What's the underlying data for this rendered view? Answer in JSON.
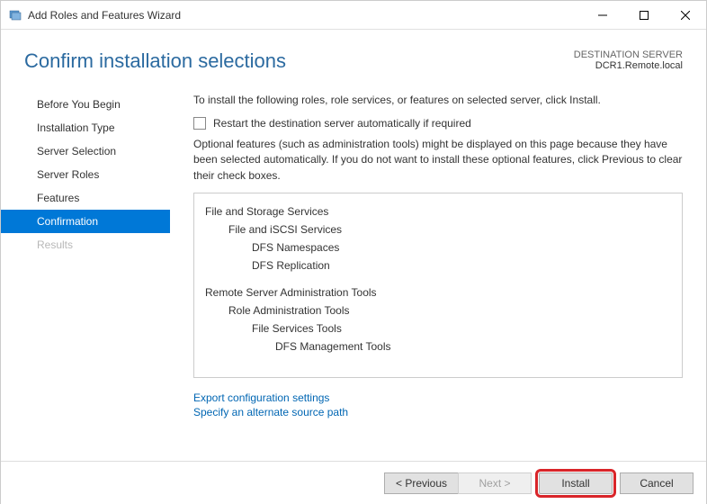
{
  "titlebar": {
    "app_icon_name": "server-manager-icon",
    "title": "Add Roles and Features Wizard"
  },
  "header": {
    "heading": "Confirm installation selections",
    "destination_label": "DESTINATION SERVER",
    "destination_value": "DCR1.Remote.local"
  },
  "sidebar": {
    "items": [
      {
        "label": "Before You Begin",
        "active": false,
        "disabled": false
      },
      {
        "label": "Installation Type",
        "active": false,
        "disabled": false
      },
      {
        "label": "Server Selection",
        "active": false,
        "disabled": false
      },
      {
        "label": "Server Roles",
        "active": false,
        "disabled": false
      },
      {
        "label": "Features",
        "active": false,
        "disabled": false
      },
      {
        "label": "Confirmation",
        "active": true,
        "disabled": false
      },
      {
        "label": "Results",
        "active": false,
        "disabled": true
      }
    ]
  },
  "content": {
    "intro": "To install the following roles, role services, or features on selected server, click Install.",
    "checkbox_label": "Restart the destination server automatically if required",
    "checkbox_checked": false,
    "note": "Optional features (such as administration tools) might be displayed on this page because they have been selected automatically. If you do not want to install these optional features, click Previous to clear their check boxes.",
    "tree": [
      {
        "label": "File and Storage Services",
        "level": 0
      },
      {
        "label": "File and iSCSI Services",
        "level": 1
      },
      {
        "label": "DFS Namespaces",
        "level": 2
      },
      {
        "label": "DFS Replication",
        "level": 2
      },
      {
        "label": "Remote Server Administration Tools",
        "level": 0,
        "gap": true
      },
      {
        "label": "Role Administration Tools",
        "level": 1
      },
      {
        "label": "File Services Tools",
        "level": 2
      },
      {
        "label": "DFS Management Tools",
        "level": 2,
        "extra_indent": true
      }
    ],
    "links": {
      "export": "Export configuration settings",
      "alt_path": "Specify an alternate source path"
    }
  },
  "footer": {
    "previous": "< Previous",
    "next": "Next >",
    "install": "Install",
    "cancel": "Cancel"
  }
}
